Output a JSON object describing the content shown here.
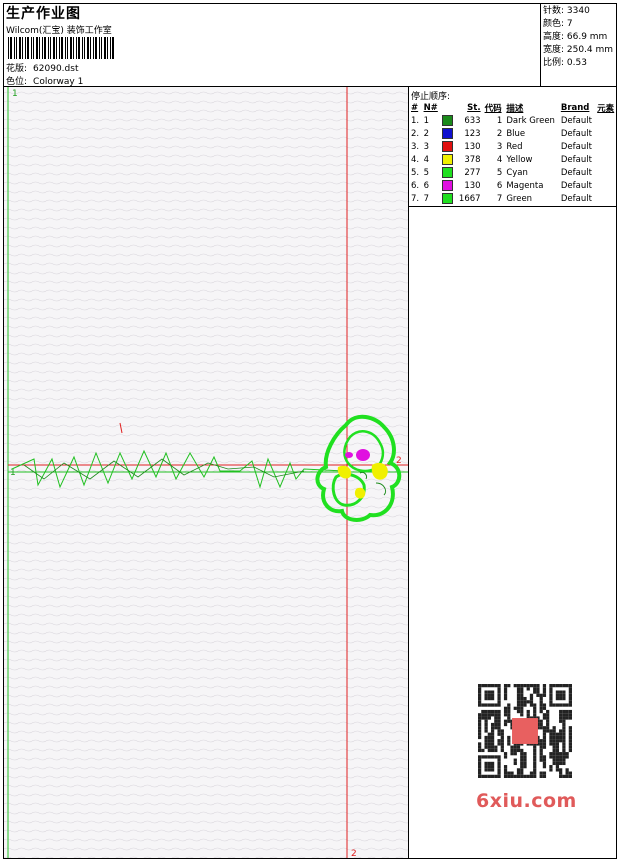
{
  "header": {
    "title": "生产作业图",
    "company": "Wilcom(汇宝) 装饰工作室",
    "design_label": "花版:",
    "design_file": "62090.dst",
    "colorway_label": "色位:",
    "colorway_value": "Colorway 1"
  },
  "meta": {
    "stitches": "针数: 3340",
    "colors": "颜色: 7",
    "height": "高度: 66.9 mm",
    "width": "宽度: 250.4 mm",
    "scale": "比例: 0.53"
  },
  "stop_sequence": {
    "title": "停止顺序:",
    "columns": [
      "#",
      "N#",
      "St.",
      "代码",
      "描述",
      "Brand",
      "元素"
    ],
    "rows": [
      {
        "seq": "1.",
        "n": "1",
        "color": "#1a8a1a",
        "st": "633",
        "code": "1",
        "desc": "Dark Green",
        "brand": "Default"
      },
      {
        "seq": "2.",
        "n": "2",
        "color": "#1010d0",
        "st": "123",
        "code": "2",
        "desc": "Blue",
        "brand": "Default"
      },
      {
        "seq": "3.",
        "n": "3",
        "color": "#e01010",
        "st": "130",
        "code": "3",
        "desc": "Red",
        "brand": "Default"
      },
      {
        "seq": "4.",
        "n": "4",
        "color": "#f0f000",
        "st": "378",
        "code": "4",
        "desc": "Yellow",
        "brand": "Default"
      },
      {
        "seq": "5.",
        "n": "5",
        "color": "#20e020",
        "st": "277",
        "code": "5",
        "desc": "Cyan",
        "brand": "Default"
      },
      {
        "seq": "6.",
        "n": "6",
        "color": "#e010e0",
        "st": "130",
        "code": "6",
        "desc": "Magenta",
        "brand": "Default"
      },
      {
        "seq": "7.",
        "n": "7",
        "color": "#20e020",
        "st": "1667",
        "code": "7",
        "desc": "Green",
        "brand": "Default"
      }
    ]
  },
  "guides": {
    "label_top_left": "1",
    "label_bottom": "2",
    "label_right": "2",
    "label_mid_left": "1"
  },
  "watermark": {
    "text": "6xiu.com"
  },
  "colors": {
    "guide_green": "#20c020",
    "guide_red": "#e02020",
    "stitch_green": "#20e020",
    "dark_green": "#1a8a1a",
    "yellow": "#f0f000",
    "magenta": "#e010e0"
  }
}
